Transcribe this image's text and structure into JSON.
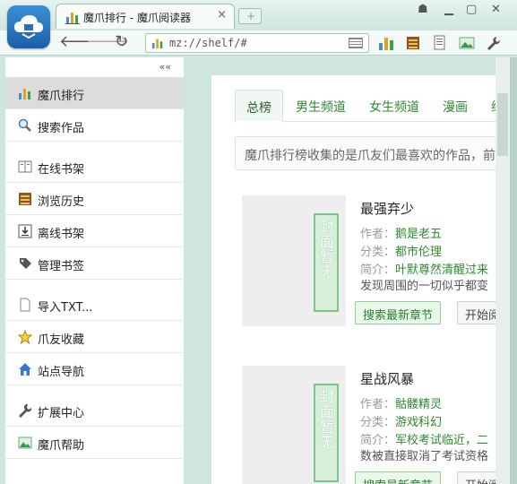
{
  "window": {
    "tab_title": "魔爪排行 - 魔爪阅读器",
    "tab_close": "×",
    "new_tab": "+"
  },
  "address_bar": {
    "url": "mz://shelf/#"
  },
  "sidebar": {
    "collapse": "««",
    "items": [
      {
        "label": "魔爪排行",
        "icon": "ranking-bar-icon"
      },
      {
        "label": "搜索作品",
        "icon": "search-icon"
      },
      {
        "label": "在线书架",
        "icon": "bookshelf-icon"
      },
      {
        "label": "浏览历史",
        "icon": "history-icon"
      },
      {
        "label": "离线书架",
        "icon": "download-icon"
      },
      {
        "label": "管理书签",
        "icon": "bookmark-tag-icon"
      },
      {
        "label": "导入TXT...",
        "icon": "document-icon"
      },
      {
        "label": "爪友收藏",
        "icon": "star-icon"
      },
      {
        "label": "站点导航",
        "icon": "home-icon"
      },
      {
        "label": "扩展中心",
        "icon": "wrench-icon"
      },
      {
        "label": "魔爪帮助",
        "icon": "help-image-icon"
      }
    ]
  },
  "content": {
    "tabs": [
      "总榜",
      "男生频道",
      "女生频道",
      "漫画",
      "综"
    ],
    "notice": "魔爪排行榜收集的是爪友们最喜欢的作品，前页",
    "cover_placeholder": "封面暂无",
    "books": [
      {
        "title": "最强弃少",
        "author_label": "作者：",
        "author": "鹅是老五",
        "category_label": "分类：",
        "category": "都市伦理",
        "intro_label": "简介：",
        "intro": "叶默尊然清醒过来",
        "desc": "发现周围的一切似乎都变",
        "search_btn": "搜索最新章节",
        "read_btn": "开始阅"
      },
      {
        "title": "星战风暴",
        "author_label": "作者：",
        "author": "骷髅精灵",
        "category_label": "分类：",
        "category": "游戏科幻",
        "intro_label": "简介：",
        "intro": "军校考试临近，二",
        "desc": "数被直接取消了考试资格",
        "search_btn": "搜索最新章节",
        "read_btn": "开始阅"
      }
    ]
  },
  "colors": {
    "accent_green": "#2f8a2f",
    "chrome_bg": "#cfe6de",
    "active_item": "#dcdcdc"
  }
}
